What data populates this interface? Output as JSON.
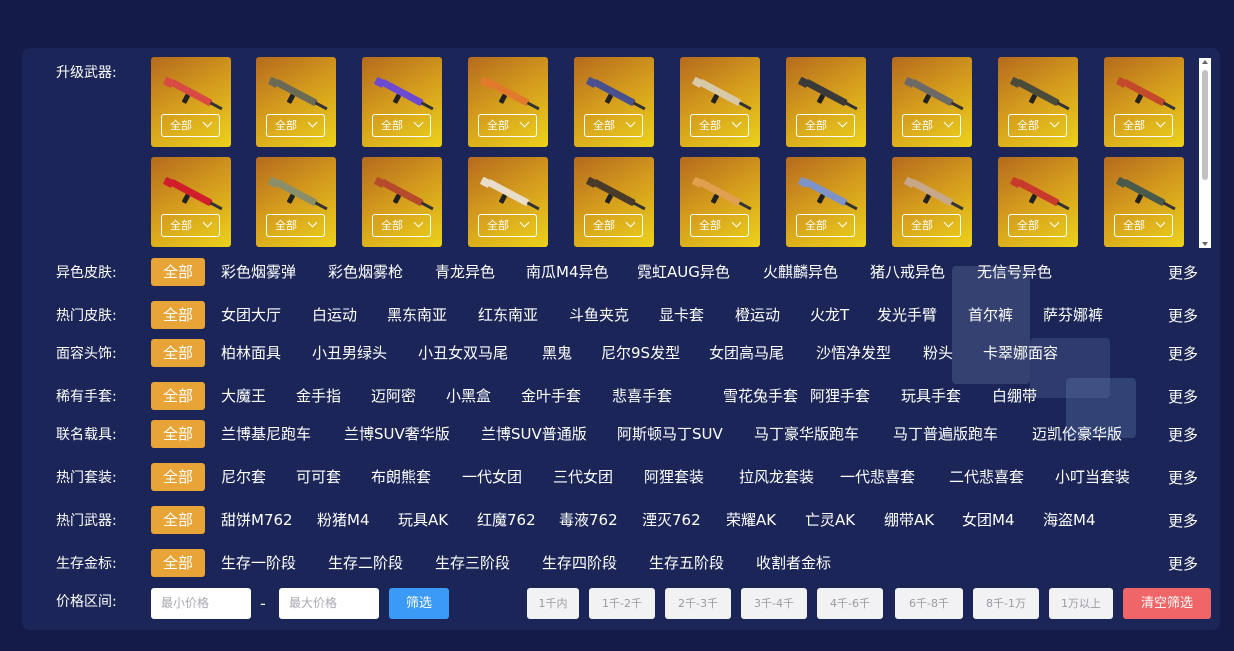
{
  "labels": {
    "upgrade": "升级武器:",
    "alt_color": "异色皮肤:",
    "hot_skin": "热门皮肤:",
    "face": "面容头饰:",
    "gloves": "稀有手套:",
    "vehicle": "联名载具:",
    "suit": "热门套装:",
    "hot_weapon": "热门武器:",
    "survival": "生存金标:",
    "price": "价格区间:"
  },
  "weapon_select_label": "全部",
  "weapons_row1": [
    "全部",
    "全部",
    "全部",
    "全部",
    "全部",
    "全部",
    "全部",
    "全部",
    "全部",
    "全部"
  ],
  "weapons_row2": [
    "全部",
    "全部",
    "全部",
    "全部",
    "全部",
    "全部",
    "全部",
    "全部",
    "全部",
    "全部"
  ],
  "weapon_colors": [
    "#d84b42",
    "#6b6a55",
    "#6c4bd0",
    "#e27a2e",
    "#4a4f8e",
    "#d7c9a8",
    "#3a3a3a",
    "#6d6a66",
    "#4b4b3a",
    "#c24a2a",
    "#d01f2a",
    "#8a8f6a",
    "#b64a2a",
    "#e9dcc8",
    "#4a3a2a",
    "#e0a050",
    "#7e93c8",
    "#c8a888",
    "#c83a2a",
    "#4a5a4a"
  ],
  "alt_color_items": [
    "全部",
    "彩色烟雾弹",
    "彩色烟雾枪",
    "青龙异色",
    "南瓜M4异色",
    "霓虹AUG异色",
    "火麒麟异色",
    "猪八戒异色",
    "无信号异色"
  ],
  "hot_skin_items": [
    "全部",
    "女团大厅",
    "白运动",
    "黑东南亚",
    "红东南亚",
    "斗鱼夹克",
    "显卡套",
    "橙运动",
    "火龙T",
    "发光手臂",
    "首尔裤",
    "萨芬娜裤"
  ],
  "face_items": [
    "全部",
    "柏林面具",
    "小丑男绿头",
    "小丑女双马尾",
    "黑鬼",
    "尼尔9S发型",
    "女团高马尾",
    "沙悟净发型",
    "粉头",
    "卡翠娜面容"
  ],
  "glove_items": [
    "全部",
    "大魔王",
    "金手指",
    "迈阿密",
    "小黑盒",
    "金叶手套",
    "悲喜手套",
    "雪花兔手套",
    "阿狸手套",
    "玩具手套",
    "白绷带"
  ],
  "vehicle_items": [
    "全部",
    "兰博基尼跑车",
    "兰博SUV奢华版",
    "兰博SUV普通版",
    "阿斯顿马丁SUV",
    "马丁豪华版跑车",
    "马丁普遍版跑车",
    "迈凯伦豪华版"
  ],
  "suit_items": [
    "全部",
    "尼尔套",
    "可可套",
    "布朗熊套",
    "一代女团",
    "三代女团",
    "阿狸套装",
    "拉风龙套装",
    "一代悲喜套",
    "二代悲喜套",
    "小叮当套装"
  ],
  "hot_weapon_items": [
    "全部",
    "甜饼M762",
    "粉猪M4",
    "玩具AK",
    "红魔762",
    "毒液762",
    "湮灭762",
    "荣耀AK",
    "亡灵AK",
    "绷带AK",
    "女团M4",
    "海盗M4"
  ],
  "survival_items": [
    "全部",
    "生存一阶段",
    "生存二阶段",
    "生存三阶段",
    "生存四阶段",
    "生存五阶段",
    "收割者金标"
  ],
  "more_label": "更多",
  "price": {
    "min_placeholder": "最小价格",
    "max_placeholder": "最大价格",
    "dash": "-",
    "filter_btn": "筛选",
    "ranges": [
      "1千内",
      "1千-2千",
      "2千-3千",
      "3千-4千",
      "4千-6千",
      "6千-8千",
      "8千-1万",
      "1万以上"
    ],
    "clear_btn": "清空筛选"
  },
  "colors": {
    "page_bg": "#151b48",
    "panel_bg": "#1b2558",
    "active_chip": "#e9a437",
    "filter_btn": "#3b9af5",
    "clear_btn": "#f06568"
  }
}
